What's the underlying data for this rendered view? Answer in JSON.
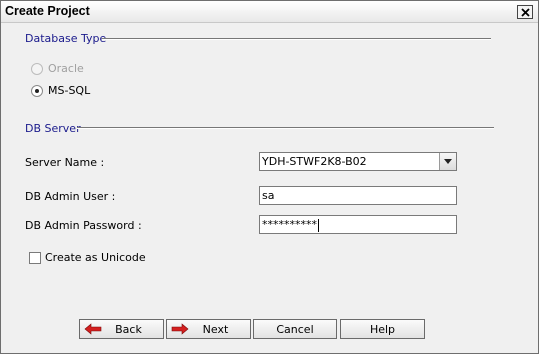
{
  "window": {
    "title": "Create Project"
  },
  "database_type": {
    "label": "Database Type",
    "options": [
      {
        "label": "Oracle",
        "selected": false,
        "disabled": true
      },
      {
        "label": "MS-SQL",
        "selected": true,
        "disabled": false
      }
    ]
  },
  "db_server": {
    "label": "DB Server",
    "server_name": {
      "label": "Server Name :",
      "value": "YDH-STWF2K8-B02"
    },
    "admin_user": {
      "label": "DB Admin User :",
      "value": "sa"
    },
    "admin_password": {
      "label": "DB Admin Password :",
      "value": "**********"
    },
    "unicode": {
      "label": "Create as Unicode",
      "checked": false
    }
  },
  "buttons": {
    "back": "Back",
    "next": "Next",
    "cancel": "Cancel",
    "help": "Help"
  },
  "colors": {
    "section_label": "#1a1a8c",
    "arrow_red": "#d42020"
  }
}
